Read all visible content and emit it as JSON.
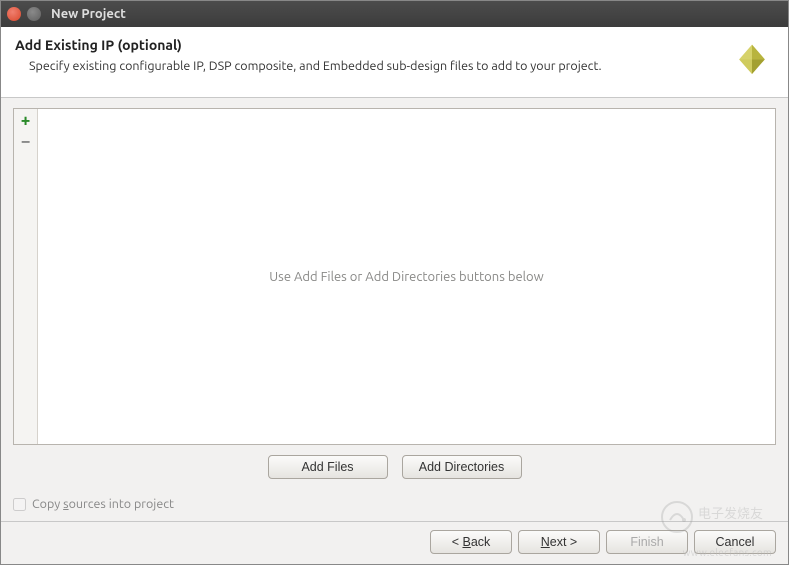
{
  "window": {
    "title": "New Project"
  },
  "header": {
    "title": "Add Existing IP (optional)",
    "description": "Specify existing configurable IP, DSP composite, and Embedded sub-design files to add to your project."
  },
  "list": {
    "placeholder": "Use Add Files or Add Directories buttons below"
  },
  "buttons": {
    "add_files": "Add Files",
    "add_directories": "Add Directories"
  },
  "options": {
    "copy_sources_label": "Copy sources into project",
    "copy_sources_checked": false
  },
  "footer": {
    "back": "< Back",
    "next": "Next >",
    "finish": "Finish",
    "cancel": "Cancel"
  },
  "watermark": {
    "brand": "电子发烧友",
    "url": "www.elecfans.com"
  }
}
